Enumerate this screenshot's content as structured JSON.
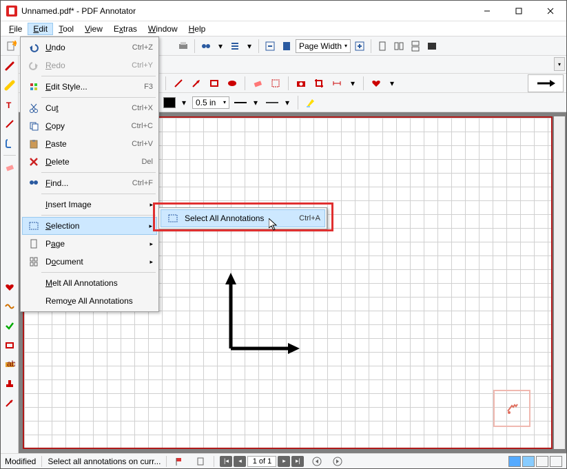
{
  "title": "Unnamed.pdf* - PDF Annotator",
  "menubar": [
    "File",
    "Edit",
    "Tool",
    "View",
    "Extras",
    "Window",
    "Help"
  ],
  "editmenu": {
    "undo": {
      "label": "Undo",
      "shortcut": "Ctrl+Z"
    },
    "redo": {
      "label": "Redo",
      "shortcut": "Ctrl+Y"
    },
    "editstyle": {
      "label": "Edit Style...",
      "shortcut": "F3"
    },
    "cut": {
      "label": "Cut",
      "shortcut": "Ctrl+X"
    },
    "copy": {
      "label": "Copy",
      "shortcut": "Ctrl+C"
    },
    "paste": {
      "label": "Paste",
      "shortcut": "Ctrl+V"
    },
    "delete": {
      "label": "Delete",
      "shortcut": "Del"
    },
    "find": {
      "label": "Find...",
      "shortcut": "Ctrl+F"
    },
    "insertimage": {
      "label": "Insert Image"
    },
    "selection": {
      "label": "Selection"
    },
    "page": {
      "label": "Page"
    },
    "document": {
      "label": "Document"
    },
    "meltall": {
      "label": "Melt All Annotations"
    },
    "removeall": {
      "label": "Remove All Annotations"
    }
  },
  "submenu": {
    "selectall": {
      "label": "Select All Annotations",
      "shortcut": "Ctrl+A"
    }
  },
  "toolbar": {
    "zoom": "Page Width"
  },
  "strokewidth": "0.5 in",
  "statusbar": {
    "modified": "Modified",
    "hint": "Select all annotations on curr...",
    "page": "1 of 1"
  }
}
